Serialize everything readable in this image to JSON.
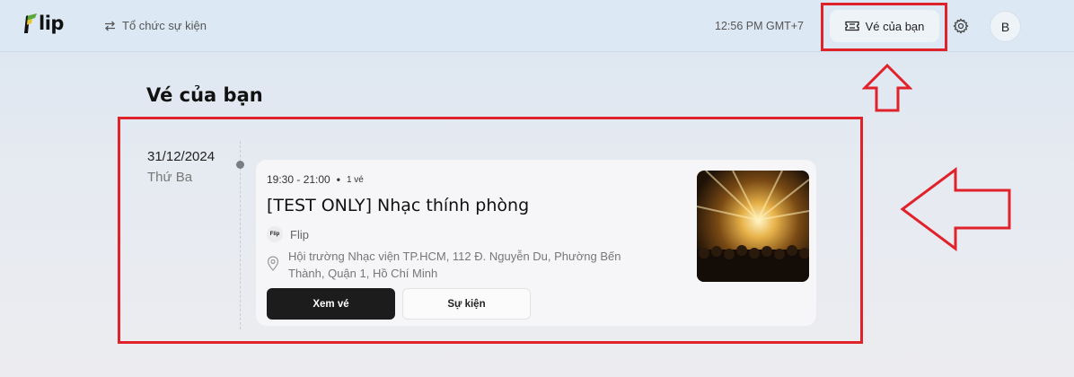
{
  "header": {
    "logo_text": "lip",
    "organize_label": "Tổ chức sự kiện",
    "clock": "12:56 PM GMT+7",
    "tickets_label": "Vé của bạn",
    "avatar_initial": "B",
    "icons": [
      "flip-logo-icon",
      "swap-arrows-icon",
      "ticket-icon",
      "gear-icon"
    ]
  },
  "page": {
    "title": "Vé của bạn"
  },
  "events": [
    {
      "date": "31/12/2024",
      "weekday": "Thứ Ba",
      "time": "19:30 - 21:00",
      "quantity": "1 vé",
      "title": "[TEST ONLY] Nhạc thính phòng",
      "organizer": "Flip",
      "organizer_logo_text": "Flip",
      "address": "Hội trường Nhạc viện TP.HCM, 112 Đ. Nguyễn Du, Phường Bến Thành, Quận 1, Hồ Chí Minh",
      "view_ticket_label": "Xem vé",
      "event_label": "Sự kiện"
    }
  ],
  "colors": {
    "header_bg": "#dce8f4",
    "primary_button": "#1c1c1c",
    "annotation_red": "#e0222a",
    "logo_green": "#5aa83a"
  }
}
